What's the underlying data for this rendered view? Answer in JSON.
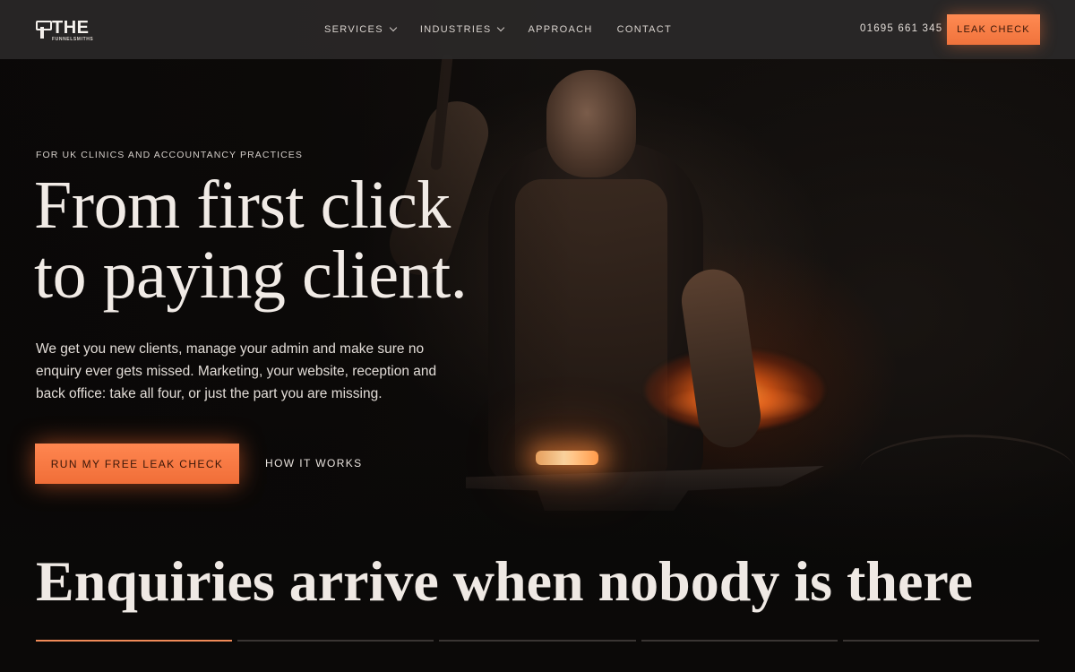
{
  "header": {
    "logo": {
      "main": "THE",
      "sub": "FUNNELSMITHS"
    },
    "nav": [
      {
        "label": "SERVICES",
        "has_dropdown": true
      },
      {
        "label": "INDUSTRIES",
        "has_dropdown": true
      },
      {
        "label": "APPROACH",
        "has_dropdown": false
      },
      {
        "label": "CONTACT",
        "has_dropdown": false
      }
    ],
    "phone": "01695 661 345",
    "cta_label": "LEAK CHECK"
  },
  "hero": {
    "eyebrow": "FOR UK CLINICS AND ACCOUNTANCY PRACTICES",
    "headline_line1": "From first click",
    "headline_line2": "to paying client.",
    "subcopy": "We get you new clients, manage your admin and make sure no enquiry ever gets missed. Marketing, your website, reception and back office: take all four, or just the part you are missing.",
    "primary_cta": "RUN MY FREE LEAK CHECK",
    "secondary_cta": "HOW IT WORKS"
  },
  "section": {
    "title": "Enquiries arrive when nobody is there",
    "progress_segments": [
      1,
      0,
      0,
      0,
      0
    ]
  },
  "colors": {
    "accent": "#f07a44",
    "header_bg": "#2a2828",
    "background": "#0b0908",
    "text": "#efe9e4"
  }
}
